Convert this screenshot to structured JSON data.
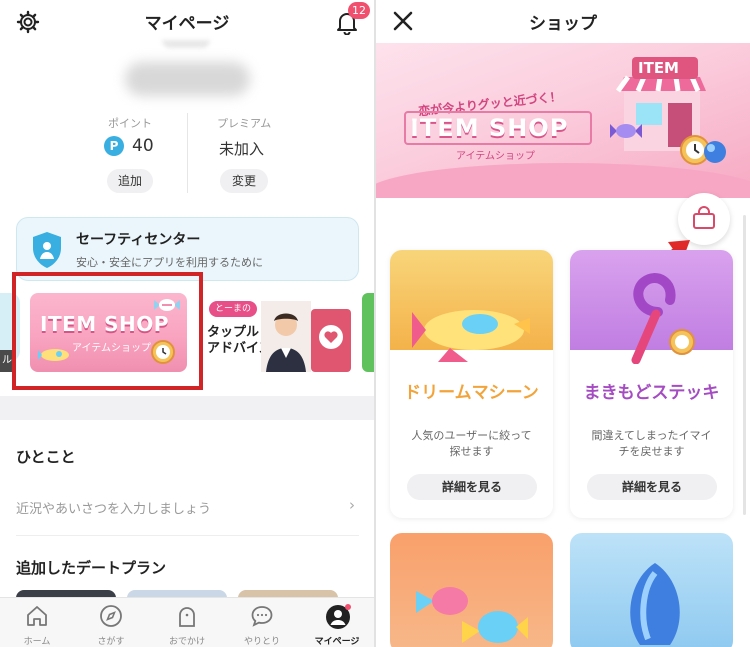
{
  "left": {
    "header": {
      "title": "マイページ",
      "notification_count": "12"
    },
    "stats": {
      "points_label": "ポイント",
      "points_value": "40",
      "points_symbol": "P",
      "add_label": "追加",
      "premium_label": "プレミアム",
      "premium_value": "未加入",
      "change_label": "変更"
    },
    "safety": {
      "title": "セーフティセンター",
      "subtitle": "安心・安全にアプリを利用するために"
    },
    "banners": {
      "left_edge_tag": "ル",
      "item_shop_title": "ITEM SHOP",
      "item_shop_sub": "アイテムショップ",
      "tapple_tag": "とーまの",
      "tapple_title_line1": "タップル",
      "tapple_title_line2": "アドバイス"
    },
    "hitokoto": {
      "heading": "ひとこと",
      "placeholder": "近況やあいさつを入力しましょう"
    },
    "date_plan": {
      "heading": "追加したデートプラン"
    },
    "tabbar": [
      {
        "label": "ホーム",
        "icon": "home-icon"
      },
      {
        "label": "さがす",
        "icon": "compass-icon"
      },
      {
        "label": "おでかけ",
        "icon": "ghost-icon"
      },
      {
        "label": "やりとり",
        "icon": "chat-icon"
      },
      {
        "label": "マイページ",
        "icon": "profile-icon"
      }
    ]
  },
  "right": {
    "header": {
      "title": "ショップ"
    },
    "hero": {
      "catchphrase": "恋が今よりグッと近づく！",
      "title": "ITEM SHOP",
      "subtitle": "アイテムショップ",
      "store_sign": "ITEM"
    },
    "products": [
      {
        "name": "ドリームマシーン",
        "desc": "人気のユーザーに絞って探せます",
        "button": "詳細を見る",
        "color": "#f2a43a"
      },
      {
        "name": "まきもどステッキ",
        "desc": "間違えてしまったイマイチを戻せます",
        "button": "詳細を見る",
        "color": "#a54cc2"
      }
    ]
  },
  "colors": {
    "accent_pink": "#f0506e",
    "highlight_red": "#d02427",
    "safety_teal": "#39aee0"
  }
}
